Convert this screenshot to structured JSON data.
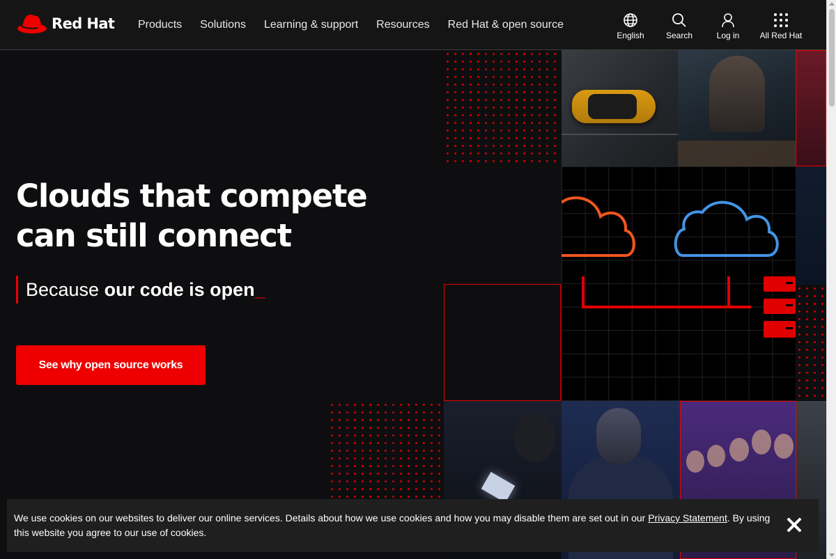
{
  "brand": {
    "name": "Red Hat",
    "accent": "#ee0000"
  },
  "nav": {
    "items": [
      "Products",
      "Solutions",
      "Learning & support",
      "Resources",
      "Red Hat & open source"
    ]
  },
  "utilities": {
    "language": {
      "label": "English",
      "icon": "globe-icon"
    },
    "search": {
      "label": "Search",
      "icon": "search-icon"
    },
    "login": {
      "label": "Log in",
      "icon": "user-icon"
    },
    "all": {
      "label": "All Red Hat",
      "icon": "grid-dots-icon"
    }
  },
  "hero": {
    "headline_line1": "Clouds that compete",
    "headline_line2": "can still connect",
    "tagline_prefix": "Because ",
    "tagline_emphasis": "our code is open",
    "tagline_cursor": "_",
    "cta_label": "See why open source works"
  },
  "cookie": {
    "text_before": "We use cookies on our websites to deliver our online services. Details about how we use cookies and how you may disable them are set out in our ",
    "link_label": "Privacy Statement",
    "text_after": ". By using this website you agree to our use of cookies.",
    "close_icon": "close-icon"
  },
  "colors": {
    "header_bg": "#151515",
    "page_bg": "#0e0e10",
    "cloud_left": "#f0561d",
    "cloud_right": "#4394e5",
    "cookie_bg": "#1f1f1f"
  }
}
